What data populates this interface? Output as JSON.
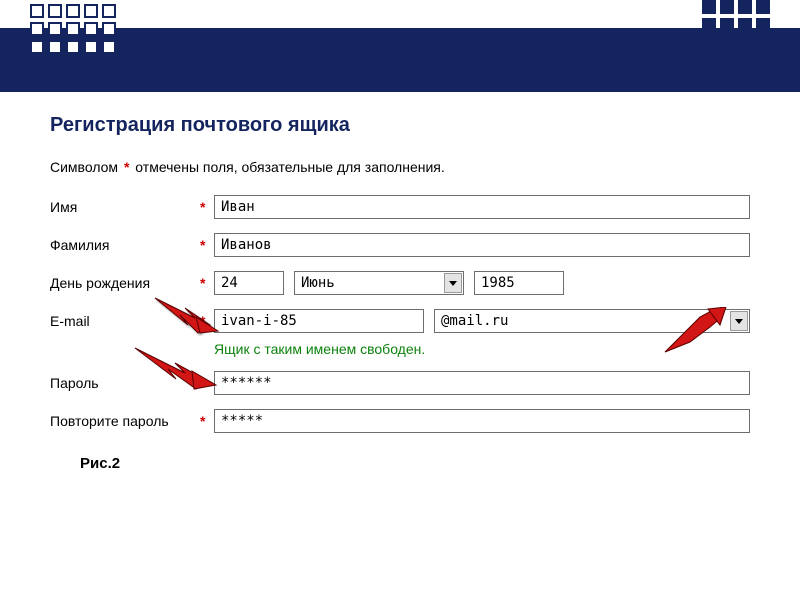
{
  "header": {
    "title": "Регистрация почтового ящика",
    "note_before": "Символом",
    "note_after": "отмечены поля, обязательные для заполнения."
  },
  "fields": {
    "first_name": {
      "label": "Имя",
      "value": "Иван"
    },
    "last_name": {
      "label": "Фамилия",
      "value": "Иванов"
    },
    "birthday": {
      "label": "День рождения",
      "day": "24",
      "month": "Июнь",
      "year": "1985"
    },
    "email": {
      "label": "E-mail",
      "value": "ivan-i-85",
      "domain": "@mail.ru",
      "success": "Ящик с таким именем свободен."
    },
    "password": {
      "label": "Пароль",
      "value": "******"
    },
    "password2": {
      "label": "Повторите пароль",
      "value": "*****"
    }
  },
  "caption": "Рис.2",
  "asterisk": "*"
}
